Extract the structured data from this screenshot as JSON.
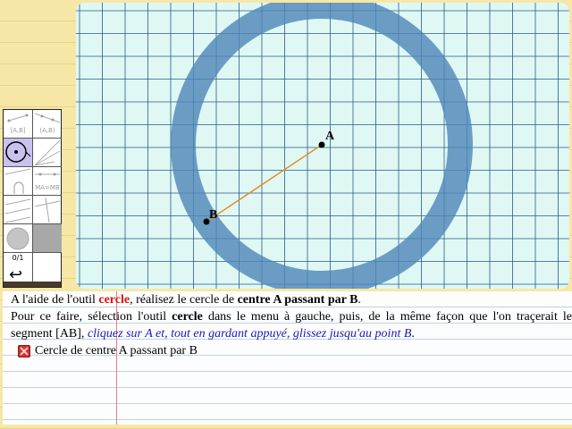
{
  "geometry": {
    "point_a_label": "A",
    "point_b_label": "B",
    "circle_color": "#4d86b8",
    "segment_color": "#e0902a"
  },
  "toolbar": {
    "tools": [
      {
        "id": "segment-ab",
        "label": "[A,B]"
      },
      {
        "id": "ray-ab",
        "label": "(A,B)"
      },
      {
        "id": "circle",
        "label": ""
      },
      {
        "id": "angle-lines",
        "label": ""
      },
      {
        "id": "arc",
        "label": ""
      },
      {
        "id": "equidistant",
        "label": "MA=MB"
      },
      {
        "id": "parallel",
        "label": ""
      },
      {
        "id": "perpendicular",
        "label": ""
      }
    ],
    "counter": "0/1",
    "undo_icon": "undo-arrow-icon"
  },
  "instructions": {
    "line1_prefix": "A l'aide de l'outil ",
    "line1_tool": "cercle",
    "line1_mid": ", réalisez le cercle de ",
    "line1_bold": "centre A passant par B",
    "line1_end": ".",
    "line2_prefix": "Pour ce faire, sélection l'outil ",
    "line2_tool": "cercle",
    "line2_mid": " dans le menu à gauche, puis, de la même façon que l'on traçerait le segment [AB], ",
    "line2_italic": "cliquez sur A et, tout en gardant appuyé, glissez jusqu'au point B",
    "line2_end": ".",
    "task_label": "Cercle de centre A passant par B"
  },
  "colors": {
    "accent_red": "#e01010",
    "instruction_blue": "#1818b8",
    "canvas_bg": "#dff8f4",
    "grid_line": "#2a5a8a"
  }
}
